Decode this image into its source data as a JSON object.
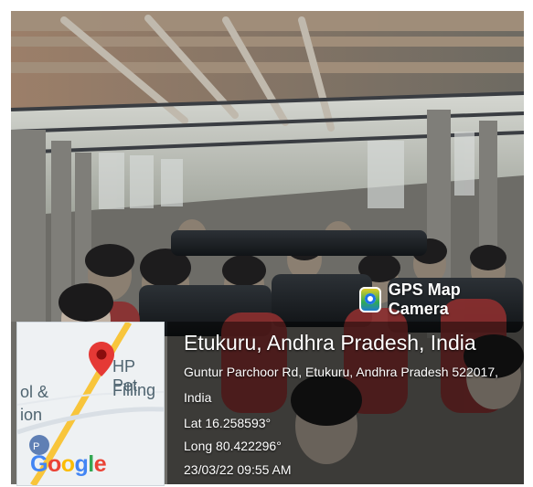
{
  "app": {
    "name": "GPS Map Camera"
  },
  "location": {
    "title": "Etukuru, Andhra Pradesh, India",
    "address_line1": "Guntur Parchoor Rd, Etukuru, Andhra Pradesh 522017,",
    "address_line2": "India",
    "lat": "Lat 16.258593°",
    "long": "Long 80.422296°",
    "timestamp": "23/03/22 09:55 AM"
  },
  "map": {
    "label_1": "HP Pet",
    "label_2": "Filling",
    "label_3": "ol &",
    "label_4": "ion",
    "provider": "Google",
    "poi_icon": "poi-icon"
  },
  "colors": {
    "pin": "#e53935",
    "road": "#f8c53b"
  }
}
